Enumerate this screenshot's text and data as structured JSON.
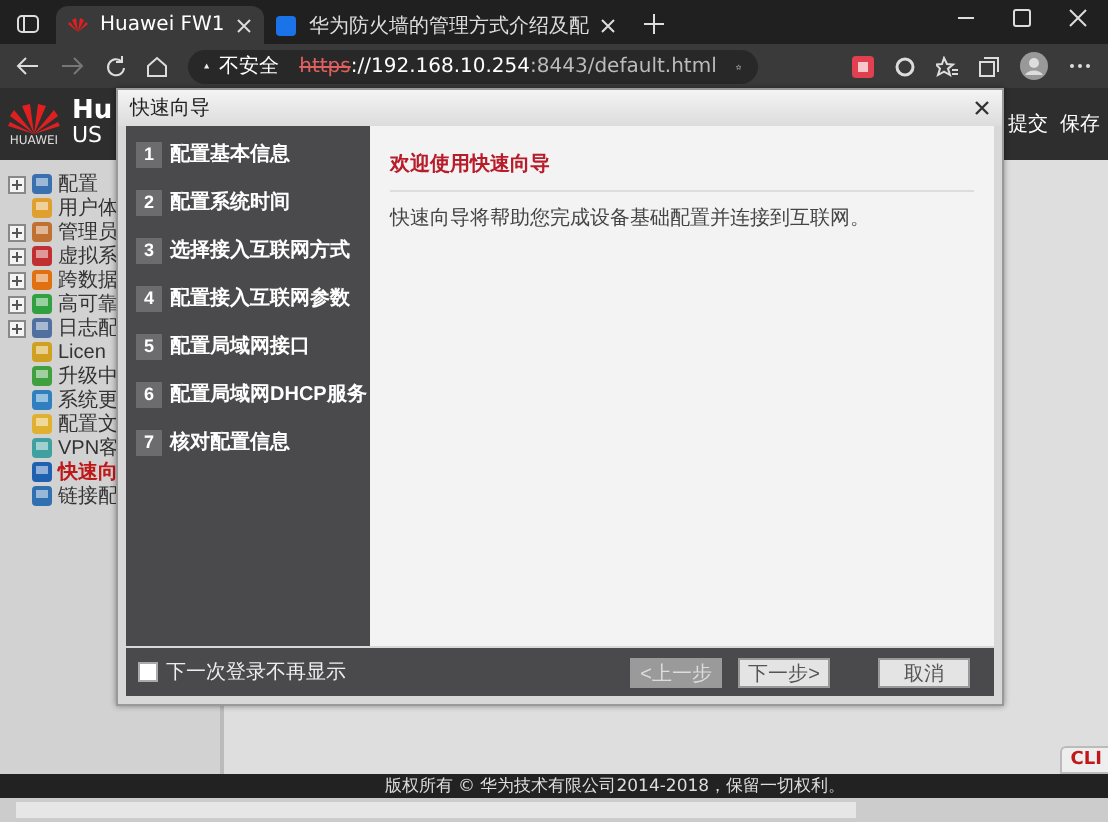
{
  "browser": {
    "tabs": [
      {
        "title": "Huawei FW1",
        "selected": true
      },
      {
        "title": "华为防火墙的管理方式介绍及配",
        "selected": false
      }
    ],
    "security": "不安全",
    "url_scheme": "https",
    "url_host": "://192.168.10.254",
    "url_rest": ":8443/default.html"
  },
  "app_header": {
    "logo_text": "HUAWEI",
    "title": "Hu",
    "subtitle": "US",
    "actions": [
      "提交",
      "保存"
    ]
  },
  "sidebar": {
    "items": [
      {
        "label": "配置",
        "expandable": true,
        "selected": false,
        "color": "#3a6fb0"
      },
      {
        "label": "用户体",
        "expandable": false,
        "selected": false,
        "color": "#e0a030"
      },
      {
        "label": "管理员",
        "expandable": true,
        "selected": false,
        "color": "#c07030"
      },
      {
        "label": "虚拟系",
        "expandable": true,
        "selected": false,
        "color": "#c03030"
      },
      {
        "label": "跨数据",
        "expandable": true,
        "selected": false,
        "color": "#e07010"
      },
      {
        "label": "高可靠",
        "expandable": true,
        "selected": false,
        "color": "#30a040"
      },
      {
        "label": "日志配",
        "expandable": true,
        "selected": false,
        "color": "#5070a0"
      },
      {
        "label": "Licen",
        "expandable": false,
        "selected": false,
        "color": "#d0a020"
      },
      {
        "label": "升级中",
        "expandable": false,
        "selected": false,
        "color": "#40a040"
      },
      {
        "label": "系统更",
        "expandable": false,
        "selected": false,
        "color": "#3080c0"
      },
      {
        "label": "配置文",
        "expandable": false,
        "selected": false,
        "color": "#e0b030"
      },
      {
        "label": "VPN客",
        "expandable": false,
        "selected": false,
        "color": "#40a0a0"
      },
      {
        "label": "快速向",
        "expandable": false,
        "selected": true,
        "color": "#2060b0"
      },
      {
        "label": "链接配",
        "expandable": false,
        "selected": false,
        "color": "#3070b0"
      }
    ]
  },
  "dialog": {
    "title": "快速向导",
    "steps": [
      {
        "number": "1",
        "label": "配置基本信息"
      },
      {
        "number": "2",
        "label": "配置系统时间"
      },
      {
        "number": "3",
        "label": "选择接入互联网方式"
      },
      {
        "number": "4",
        "label": "配置接入互联网参数"
      },
      {
        "number": "5",
        "label": "配置局域网接口"
      },
      {
        "number": "6",
        "label": "配置局域网DHCP服务"
      },
      {
        "number": "7",
        "label": "核对配置信息"
      }
    ],
    "heading": "欢迎使用快速向导",
    "description": "快速向导将帮助您完成设备基础配置并连接到互联网。",
    "dont_show_again": {
      "label": "下一次登录不再显示",
      "checked": false
    },
    "buttons": [
      {
        "label": "<上一步",
        "disabled": true
      },
      {
        "label": "下一步>",
        "disabled": false
      },
      {
        "label": "取消",
        "disabled": false
      }
    ]
  },
  "cli_tab": "CLI",
  "footer": "版权所有 © 华为技术有限公司2014-2018，保留一切权利。"
}
